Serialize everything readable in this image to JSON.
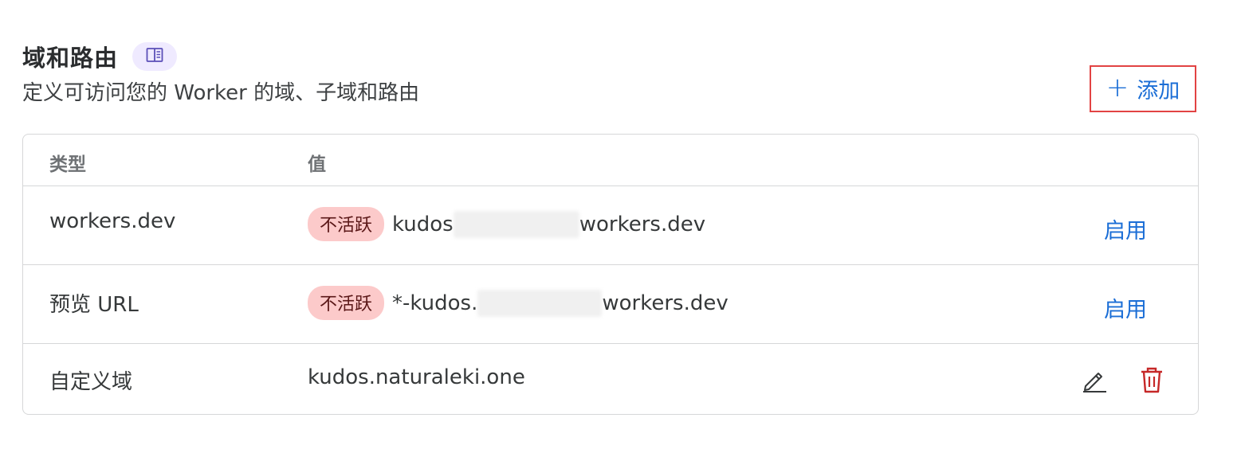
{
  "section": {
    "title": "域和路由",
    "doc_icon": "book-open-icon",
    "subtitle": "定义可访问您的 Worker 的域、子域和路由",
    "add_button": {
      "plus_icon": "+",
      "label": "添加"
    }
  },
  "table": {
    "columns": {
      "type": "类型",
      "value": "值"
    },
    "rows": [
      {
        "type": "workers.dev",
        "badge": "不活跃",
        "value_prefix": "kudos",
        "value_suffix": "workers.dev",
        "action": "启用"
      },
      {
        "type": "预览 URL",
        "badge": "不活跃",
        "value_prefix": "*-kudos.",
        "value_suffix": "workers.dev",
        "action": "启用"
      },
      {
        "type": "自定义域",
        "value": "kudos.naturaleki.one",
        "edit_icon": "pencil-icon",
        "delete_icon": "trash-icon"
      }
    ]
  },
  "colors": {
    "accent": "#1b6ed6",
    "danger": "#c62828",
    "badge_bg": "#fccaca",
    "highlight_border": "#e24343"
  }
}
